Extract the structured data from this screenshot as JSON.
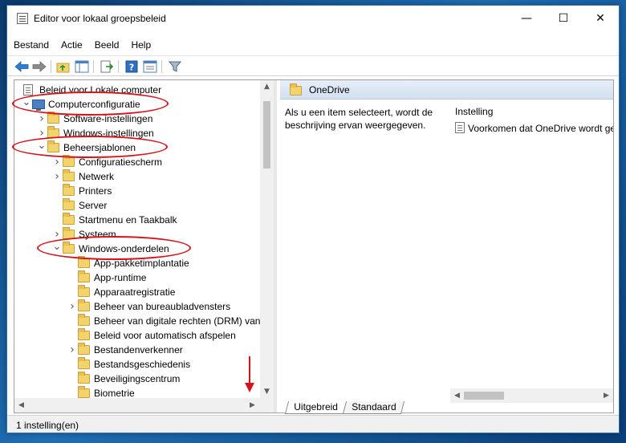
{
  "window": {
    "title": "Editor voor lokaal groepsbeleid",
    "minimize_glyph": "—",
    "maximize_glyph": "☐",
    "close_glyph": "✕"
  },
  "menu": {
    "items": [
      "Bestand",
      "Actie",
      "Beeld",
      "Help"
    ]
  },
  "toolbar": {
    "icons": [
      "back-icon",
      "forward-icon",
      "up-folder-icon",
      "show-hide-tree-icon",
      "export-list-icon",
      "help-icon",
      "properties-icon",
      "filter-icon"
    ]
  },
  "tree": {
    "items": [
      {
        "label": "Beleid voor Lokale computer",
        "level": 0,
        "icon": "document-icon",
        "expander": ""
      },
      {
        "label": "Computerconfiguratie",
        "level": 0,
        "icon": "computer-icon",
        "expander": "expanded"
      },
      {
        "label": "Software-instellingen",
        "level": 1,
        "icon": "folder-icon",
        "expander": "collapsed"
      },
      {
        "label": "Windows-instellingen",
        "level": 1,
        "icon": "folder-icon",
        "expander": "collapsed"
      },
      {
        "label": "Beheersjablonen",
        "level": 1,
        "icon": "folder-icon",
        "expander": "expanded"
      },
      {
        "label": "Configuratiescherm",
        "level": 2,
        "icon": "folder-icon",
        "expander": "collapsed"
      },
      {
        "label": "Netwerk",
        "level": 2,
        "icon": "folder-icon",
        "expander": "collapsed"
      },
      {
        "label": "Printers",
        "level": 2,
        "icon": "folder-icon",
        "expander": ""
      },
      {
        "label": "Server",
        "level": 2,
        "icon": "folder-icon",
        "expander": ""
      },
      {
        "label": "Startmenu en Taakbalk",
        "level": 2,
        "icon": "folder-icon",
        "expander": ""
      },
      {
        "label": "Systeem",
        "level": 2,
        "icon": "folder-icon",
        "expander": "collapsed"
      },
      {
        "label": "Windows-onderdelen",
        "level": 2,
        "icon": "folder-icon",
        "expander": "expanded"
      },
      {
        "label": "App-pakketimplantatie",
        "level": 3,
        "icon": "folder-icon",
        "expander": ""
      },
      {
        "label": "App-runtime",
        "level": 3,
        "icon": "folder-icon",
        "expander": ""
      },
      {
        "label": "Apparaatregistratie",
        "level": 3,
        "icon": "folder-icon",
        "expander": ""
      },
      {
        "label": "Beheer van bureaubladvensters",
        "level": 3,
        "icon": "folder-icon",
        "expander": "collapsed"
      },
      {
        "label": "Beheer van digitale rechten (DRM) van Windows Media",
        "level": 3,
        "icon": "folder-icon",
        "expander": ""
      },
      {
        "label": "Beleid voor automatisch afspelen",
        "level": 3,
        "icon": "folder-icon",
        "expander": ""
      },
      {
        "label": "Bestandenverkenner",
        "level": 3,
        "icon": "folder-icon",
        "expander": "collapsed"
      },
      {
        "label": "Bestandsgeschiedenis",
        "level": 3,
        "icon": "folder-icon",
        "expander": ""
      },
      {
        "label": "Beveiligingscentrum",
        "level": 3,
        "icon": "folder-icon",
        "expander": ""
      },
      {
        "label": "Biometrie",
        "level": 3,
        "icon": "folder-icon",
        "expander": ""
      }
    ]
  },
  "right_pane": {
    "header": "OneDrive",
    "description": "Als u een item selecteert, wordt de beschrijving ervan weergegeven.",
    "column_header": "Instelling",
    "policy_item": "Voorkomen dat OneDrive wordt gebruikt voor bestandsopslag"
  },
  "tabs": {
    "extended": "Uitgebreid",
    "standard": "Standaard"
  },
  "status": {
    "text": "1 instelling(en)"
  },
  "colors": {
    "annotation": "#d6121b",
    "folder": "#f3d36b",
    "header_bg": "#dce6f2"
  }
}
